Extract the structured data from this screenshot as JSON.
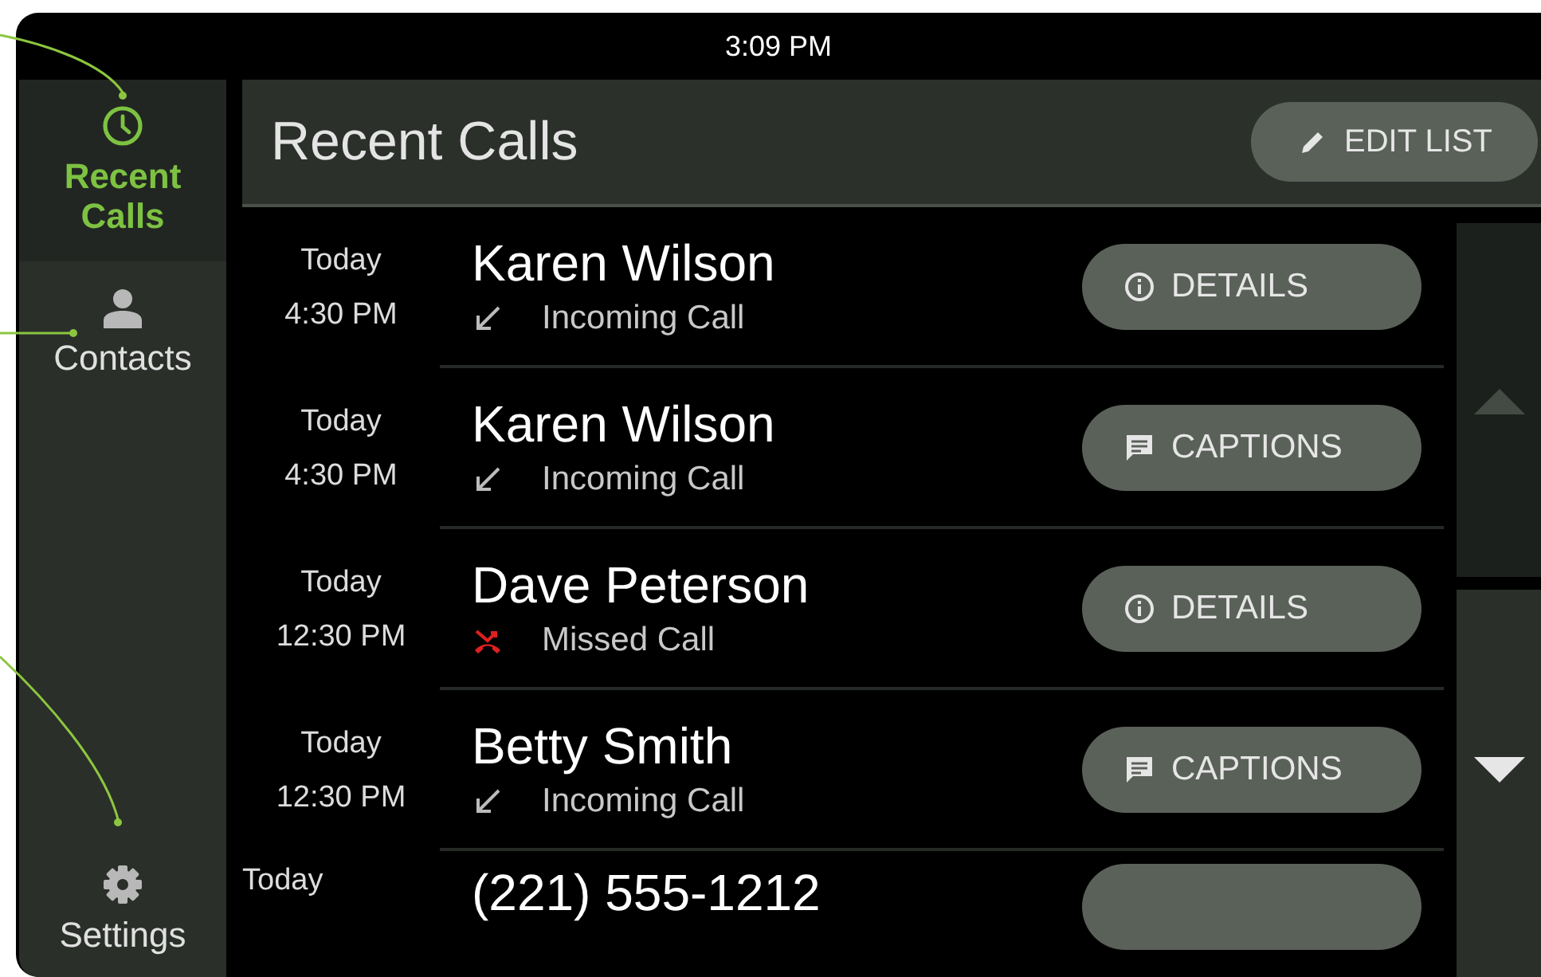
{
  "status_bar": {
    "time": "3:09 PM"
  },
  "sidebar": {
    "items": [
      {
        "label": "Recent Calls",
        "kind": "clock",
        "selected": true
      },
      {
        "label": "Contacts",
        "kind": "person",
        "selected": false
      },
      {
        "label": "Settings",
        "kind": "gear",
        "selected": false
      }
    ]
  },
  "header": {
    "title": "Recent Calls",
    "edit_button": "EDIT LIST"
  },
  "calls": [
    {
      "day": "Today",
      "time": "4:30 PM",
      "name": "Karen Wilson",
      "kind": "incoming",
      "type_label": "Incoming Call",
      "action": {
        "kind": "details",
        "label": "DETAILS"
      }
    },
    {
      "day": "Today",
      "time": "4:30 PM",
      "name": "Karen Wilson",
      "kind": "incoming",
      "type_label": "Incoming Call",
      "action": {
        "kind": "captions",
        "label": "CAPTIONS"
      }
    },
    {
      "day": "Today",
      "time": "12:30 PM",
      "name": "Dave Peterson",
      "kind": "missed",
      "type_label": "Missed Call",
      "action": {
        "kind": "details",
        "label": "DETAILS"
      }
    },
    {
      "day": "Today",
      "time": "12:30 PM",
      "name": "Betty Smith",
      "kind": "incoming",
      "type_label": "Incoming Call",
      "action": {
        "kind": "captions",
        "label": "CAPTIONS"
      }
    },
    {
      "day": "Today",
      "name": "(221) 555-1212"
    }
  ]
}
